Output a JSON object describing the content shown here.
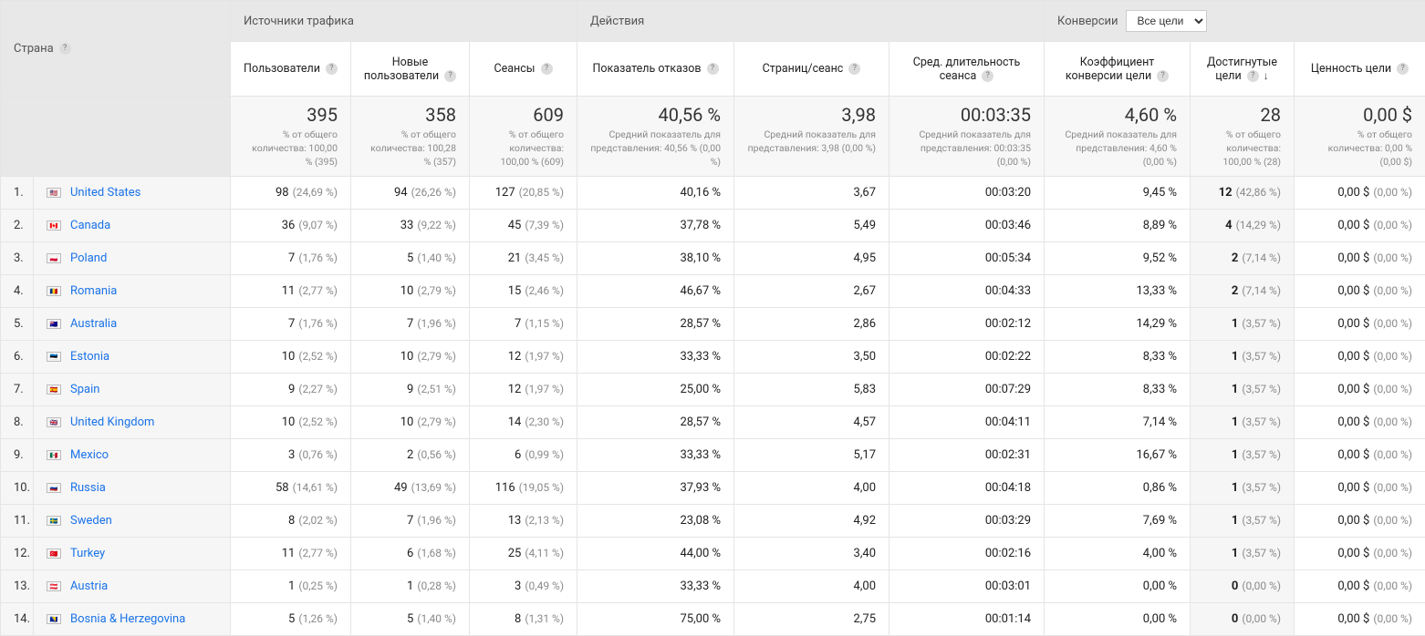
{
  "headers": {
    "country": "Страна",
    "traffic_sources": "Источники трафика",
    "actions": "Действия",
    "conversions_label": "Конверсии",
    "goals_select": "Все цели",
    "users": "Пользователи",
    "new_users": "Новые пользователи",
    "sessions": "Сеансы",
    "bounce": "Показатель отказов",
    "pps": "Страниц/сеанс",
    "duration": "Сред. длительность сеанса",
    "conv_rate": "Коэффициент конверсии цели",
    "goals_done": "Достигнутые цели",
    "goal_value": "Ценность цели"
  },
  "summary": {
    "users": {
      "big": "395",
      "sub": "% от общего количества: 100,00 % (395)"
    },
    "new_users": {
      "big": "358",
      "sub": "% от общего количества: 100,28 % (357)"
    },
    "sessions": {
      "big": "609",
      "sub": "% от общего количества: 100,00 % (609)"
    },
    "bounce": {
      "big": "40,56 %",
      "sub": "Средний показатель для представления: 40,56 % (0,00 %)"
    },
    "pps": {
      "big": "3,98",
      "sub": "Средний показатель для представления: 3,98 (0,00 %)"
    },
    "duration": {
      "big": "00:03:35",
      "sub": "Средний показатель для представления: 00:03:35 (0,00 %)"
    },
    "conv": {
      "big": "4,60 %",
      "sub": "Средний показатель для представления: 4,60 % (0,00 %)"
    },
    "goals": {
      "big": "28",
      "sub": "% от общего количества: 100,00 % (28)"
    },
    "value": {
      "big": "0,00 $",
      "sub": "% от общего количества: 0,00 % (0,00 $)"
    }
  },
  "rows": [
    {
      "i": "1.",
      "flag": "🇺🇸",
      "country": "United States",
      "users": "98",
      "users_p": "(24,69 %)",
      "new": "94",
      "new_p": "(26,26 %)",
      "sess": "127",
      "sess_p": "(20,85 %)",
      "bounce": "40,16 %",
      "pps": "3,67",
      "dur": "00:03:20",
      "conv": "9,45 %",
      "goals": "12",
      "goals_p": "(42,86 %)",
      "val": "0,00 $",
      "val_p": "(0,00 %)"
    },
    {
      "i": "2.",
      "flag": "🇨🇦",
      "country": "Canada",
      "users": "36",
      "users_p": "(9,07 %)",
      "new": "33",
      "new_p": "(9,22 %)",
      "sess": "45",
      "sess_p": "(7,39 %)",
      "bounce": "37,78 %",
      "pps": "5,49",
      "dur": "00:03:46",
      "conv": "8,89 %",
      "goals": "4",
      "goals_p": "(14,29 %)",
      "val": "0,00 $",
      "val_p": "(0,00 %)"
    },
    {
      "i": "3.",
      "flag": "🇵🇱",
      "country": "Poland",
      "users": "7",
      "users_p": "(1,76 %)",
      "new": "5",
      "new_p": "(1,40 %)",
      "sess": "21",
      "sess_p": "(3,45 %)",
      "bounce": "38,10 %",
      "pps": "4,95",
      "dur": "00:05:34",
      "conv": "9,52 %",
      "goals": "2",
      "goals_p": "(7,14 %)",
      "val": "0,00 $",
      "val_p": "(0,00 %)"
    },
    {
      "i": "4.",
      "flag": "🇷🇴",
      "country": "Romania",
      "users": "11",
      "users_p": "(2,77 %)",
      "new": "10",
      "new_p": "(2,79 %)",
      "sess": "15",
      "sess_p": "(2,46 %)",
      "bounce": "46,67 %",
      "pps": "2,67",
      "dur": "00:04:33",
      "conv": "13,33 %",
      "goals": "2",
      "goals_p": "(7,14 %)",
      "val": "0,00 $",
      "val_p": "(0,00 %)"
    },
    {
      "i": "5.",
      "flag": "🇦🇺",
      "country": "Australia",
      "users": "7",
      "users_p": "(1,76 %)",
      "new": "7",
      "new_p": "(1,96 %)",
      "sess": "7",
      "sess_p": "(1,15 %)",
      "bounce": "28,57 %",
      "pps": "2,86",
      "dur": "00:02:12",
      "conv": "14,29 %",
      "goals": "1",
      "goals_p": "(3,57 %)",
      "val": "0,00 $",
      "val_p": "(0,00 %)"
    },
    {
      "i": "6.",
      "flag": "🇪🇪",
      "country": "Estonia",
      "users": "10",
      "users_p": "(2,52 %)",
      "new": "10",
      "new_p": "(2,79 %)",
      "sess": "12",
      "sess_p": "(1,97 %)",
      "bounce": "33,33 %",
      "pps": "3,50",
      "dur": "00:02:22",
      "conv": "8,33 %",
      "goals": "1",
      "goals_p": "(3,57 %)",
      "val": "0,00 $",
      "val_p": "(0,00 %)"
    },
    {
      "i": "7.",
      "flag": "🇪🇸",
      "country": "Spain",
      "users": "9",
      "users_p": "(2,27 %)",
      "new": "9",
      "new_p": "(2,51 %)",
      "sess": "12",
      "sess_p": "(1,97 %)",
      "bounce": "25,00 %",
      "pps": "5,83",
      "dur": "00:07:29",
      "conv": "8,33 %",
      "goals": "1",
      "goals_p": "(3,57 %)",
      "val": "0,00 $",
      "val_p": "(0,00 %)"
    },
    {
      "i": "8.",
      "flag": "🇬🇧",
      "country": "United Kingdom",
      "users": "10",
      "users_p": "(2,52 %)",
      "new": "10",
      "new_p": "(2,79 %)",
      "sess": "14",
      "sess_p": "(2,30 %)",
      "bounce": "28,57 %",
      "pps": "4,57",
      "dur": "00:04:11",
      "conv": "7,14 %",
      "goals": "1",
      "goals_p": "(3,57 %)",
      "val": "0,00 $",
      "val_p": "(0,00 %)"
    },
    {
      "i": "9.",
      "flag": "🇲🇽",
      "country": "Mexico",
      "users": "3",
      "users_p": "(0,76 %)",
      "new": "2",
      "new_p": "(0,56 %)",
      "sess": "6",
      "sess_p": "(0,99 %)",
      "bounce": "33,33 %",
      "pps": "5,17",
      "dur": "00:02:31",
      "conv": "16,67 %",
      "goals": "1",
      "goals_p": "(3,57 %)",
      "val": "0,00 $",
      "val_p": "(0,00 %)"
    },
    {
      "i": "10.",
      "flag": "🇷🇺",
      "country": "Russia",
      "users": "58",
      "users_p": "(14,61 %)",
      "new": "49",
      "new_p": "(13,69 %)",
      "sess": "116",
      "sess_p": "(19,05 %)",
      "bounce": "37,93 %",
      "pps": "4,00",
      "dur": "00:04:18",
      "conv": "0,86 %",
      "goals": "1",
      "goals_p": "(3,57 %)",
      "val": "0,00 $",
      "val_p": "(0,00 %)"
    },
    {
      "i": "11.",
      "flag": "🇸🇪",
      "country": "Sweden",
      "users": "8",
      "users_p": "(2,02 %)",
      "new": "7",
      "new_p": "(1,96 %)",
      "sess": "13",
      "sess_p": "(2,13 %)",
      "bounce": "23,08 %",
      "pps": "4,92",
      "dur": "00:03:29",
      "conv": "7,69 %",
      "goals": "1",
      "goals_p": "(3,57 %)",
      "val": "0,00 $",
      "val_p": "(0,00 %)"
    },
    {
      "i": "12.",
      "flag": "🇹🇷",
      "country": "Turkey",
      "users": "11",
      "users_p": "(2,77 %)",
      "new": "6",
      "new_p": "(1,68 %)",
      "sess": "25",
      "sess_p": "(4,11 %)",
      "bounce": "44,00 %",
      "pps": "3,40",
      "dur": "00:02:16",
      "conv": "4,00 %",
      "goals": "1",
      "goals_p": "(3,57 %)",
      "val": "0,00 $",
      "val_p": "(0,00 %)"
    },
    {
      "i": "13.",
      "flag": "🇦🇹",
      "country": "Austria",
      "users": "1",
      "users_p": "(0,25 %)",
      "new": "1",
      "new_p": "(0,28 %)",
      "sess": "3",
      "sess_p": "(0,49 %)",
      "bounce": "33,33 %",
      "pps": "4,00",
      "dur": "00:03:01",
      "conv": "0,00 %",
      "goals": "0",
      "goals_p": "(0,00 %)",
      "val": "0,00 $",
      "val_p": "(0,00 %)"
    },
    {
      "i": "14.",
      "flag": "🇧🇦",
      "country": "Bosnia & Herzegovina",
      "users": "5",
      "users_p": "(1,26 %)",
      "new": "5",
      "new_p": "(1,40 %)",
      "sess": "8",
      "sess_p": "(1,31 %)",
      "bounce": "75,00 %",
      "pps": "2,75",
      "dur": "00:01:14",
      "conv": "0,00 %",
      "goals": "0",
      "goals_p": "(0,00 %)",
      "val": "0,00 $",
      "val_p": "(0,00 %)"
    }
  ]
}
